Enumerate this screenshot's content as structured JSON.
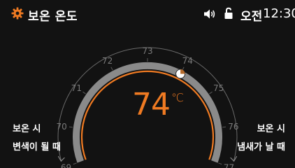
{
  "header": {
    "app_title": "보온 온도",
    "app_icon": "gear-icon",
    "sound_icon": "speaker-icon",
    "lock_icon": "unlock-icon",
    "ampm": "오전",
    "time": "12:30"
  },
  "gauge": {
    "ticks": [
      "69",
      "70",
      "71",
      "72",
      "73",
      "74",
      "75",
      "76",
      "77"
    ],
    "min": 69,
    "max": 77,
    "setpoint": 74,
    "unit": "℃",
    "colors": {
      "accent": "#ef7a22",
      "track": "#8a8a8a",
      "tick_label": "#7a7a7a",
      "knob": "#ffffff"
    }
  },
  "labels": {
    "left_line1": "보온 시",
    "left_line2": "변색이 될 때",
    "right_line1": "보온 시",
    "right_line2": "냄새가 날 때"
  }
}
